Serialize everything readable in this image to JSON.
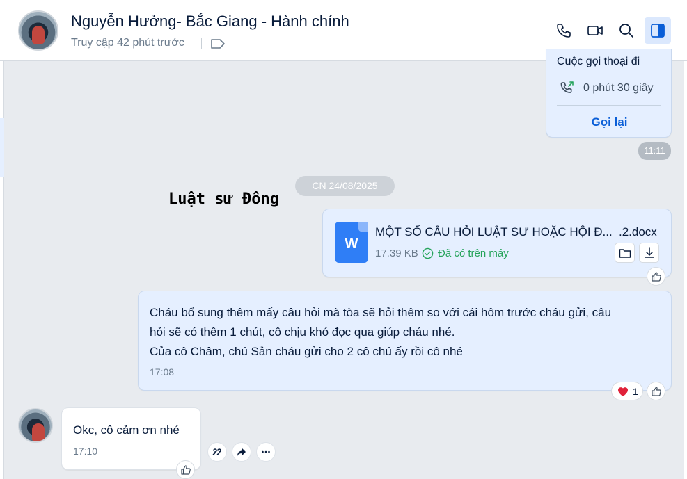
{
  "header": {
    "contact_name": "Nguyễn Hưởng-  Bắc Giang - Hành chính",
    "status": "Truy cập 42 phút trước",
    "buttons": {
      "call": "phone-icon",
      "video": "video-icon",
      "search": "search-icon",
      "side_panel": "sidebar-panel-icon"
    }
  },
  "call_card": {
    "title": "Cuộc gọi thoại đi",
    "duration": "0 phút 30 giây",
    "action": "Gọi lại",
    "time": "11:11"
  },
  "date_separator": "CN 24/08/2025",
  "sender_label": "Luật sư Đông",
  "file_message": {
    "file_name": "MỘT SỐ CÂU HỎI LUẬT SƯ HOẶC HỘI Đ...",
    "file_ext": ".2.docx",
    "icon_letter": "W",
    "size": "17.39 KB",
    "status": "Đã có trên máy"
  },
  "text_message": {
    "lines": [
      "Cháu bổ sung thêm mấy câu hỏi mà tòa sẽ hỏi thêm so với cái hôm trước cháu gửi, câu",
      "hỏi sẽ có thêm 1 chút, cô chịu khó đọc qua giúp cháu nhé.",
      "Của cô Châm, chú Sản cháu gửi cho 2 cô chú ấy rồi cô nhé"
    ],
    "time": "17:08",
    "reaction_count": "1"
  },
  "reply_message": {
    "text": "Okc, cô cảm ơn nhé",
    "time": "17:10"
  },
  "colors": {
    "accent": "#0a5ed7",
    "my_bubble": "#e5efff",
    "chat_background": "#e8ebef",
    "success": "#25a35a"
  }
}
